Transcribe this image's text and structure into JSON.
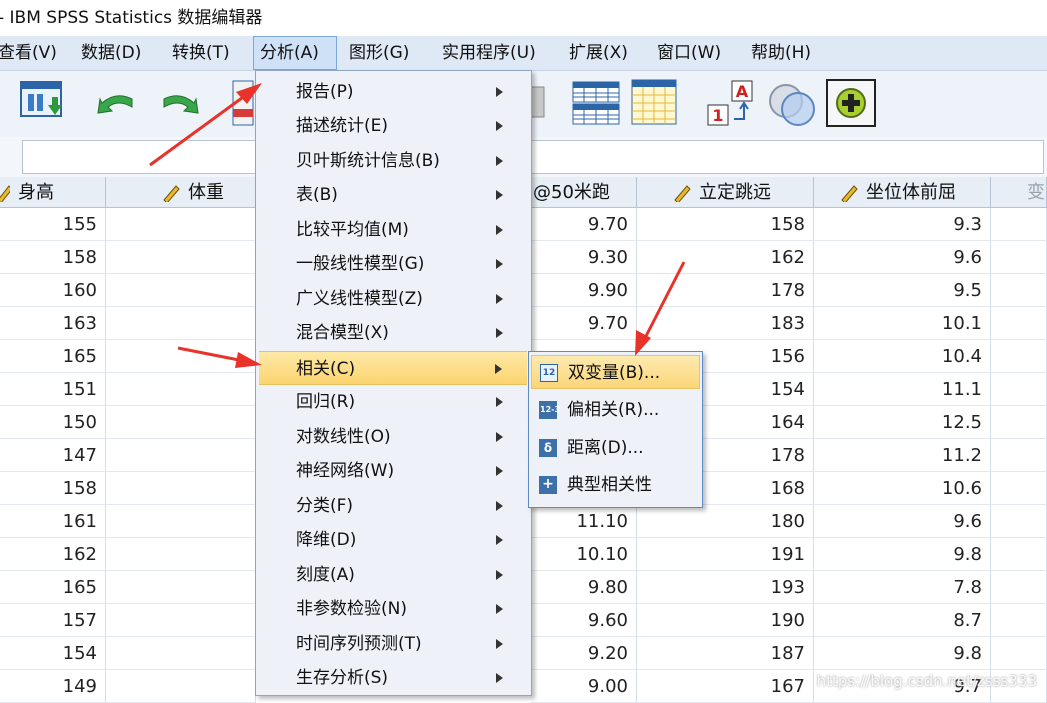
{
  "window": {
    "title": "- IBM SPSS Statistics 数据编辑器"
  },
  "menubar": {
    "items": [
      "查看(V)",
      "数据(D)",
      "转换(T)",
      "分析(A)",
      "图形(G)",
      "实用程序(U)",
      "扩展(X)",
      "窗口(W)",
      "帮助(H)"
    ]
  },
  "toolbar": {
    "icons": [
      "save-data-icon",
      "undo-icon",
      "redo-icon",
      "goto-case-icon",
      "goto-variable-icon",
      "variables-grid-icon",
      "split-file-icon",
      "value-labels-icon",
      "sets-icon",
      "add-circle-icon"
    ]
  },
  "grid": {
    "columns": [
      "身高",
      "体重",
      "@50米跑",
      "立定跳远",
      "坐位体前屈",
      "变"
    ],
    "rows": [
      [
        "155",
        "",
        "9.70",
        "158",
        "9.3"
      ],
      [
        "158",
        "",
        "9.30",
        "162",
        "9.6"
      ],
      [
        "160",
        "",
        "9.90",
        "178",
        "9.5"
      ],
      [
        "163",
        "",
        "9.70",
        "183",
        "10.1"
      ],
      [
        "165",
        "",
        "",
        "156",
        "10.4"
      ],
      [
        "151",
        "",
        "",
        "154",
        "11.1"
      ],
      [
        "150",
        "",
        "",
        "164",
        "12.5"
      ],
      [
        "147",
        "",
        "",
        "178",
        "11.2"
      ],
      [
        "158",
        "",
        "",
        "168",
        "10.6"
      ],
      [
        "161",
        "",
        "11.10",
        "180",
        "9.6"
      ],
      [
        "162",
        "",
        "10.10",
        "191",
        "9.8"
      ],
      [
        "165",
        "",
        "9.80",
        "193",
        "7.8"
      ],
      [
        "157",
        "",
        "9.60",
        "190",
        "8.7"
      ],
      [
        "154",
        "",
        "9.20",
        "187",
        "9.8"
      ],
      [
        "149",
        "",
        "9.00",
        "167",
        "9.7"
      ]
    ]
  },
  "analyze_menu": {
    "items": [
      "报告(P)",
      "描述统计(E)",
      "贝叶斯统计信息(B)",
      "表(B)",
      "比较平均值(M)",
      "一般线性模型(G)",
      "广义线性模型(Z)",
      "混合模型(X)",
      "相关(C)",
      "回归(R)",
      "对数线性(O)",
      "神经网络(W)",
      "分类(F)",
      "降维(D)",
      "刻度(A)",
      "非参数检验(N)",
      "时间序列预测(T)",
      "生存分析(S)"
    ],
    "highlighted": "相关(C)"
  },
  "correlate_submenu": {
    "items": [
      "双变量(B)...",
      "偏相关(R)...",
      "距离(D)...",
      "典型相关性"
    ],
    "icons": [
      "bivariate-icon",
      "partial-icon",
      "distance-icon",
      "canonical-icon"
    ]
  },
  "annotation_color": "#e8322a",
  "watermark": "https://blog.csdn.net/zsss333"
}
